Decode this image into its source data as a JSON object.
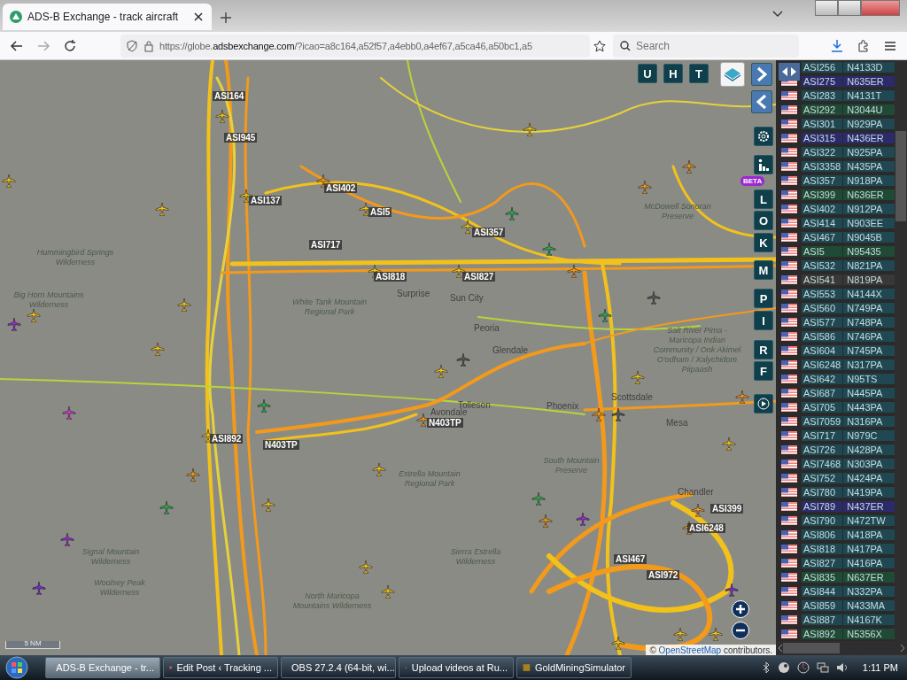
{
  "browser": {
    "tab": {
      "title": "ADS-B Exchange - track aircraft",
      "selected": true
    },
    "url": {
      "scheme": "https://globe.",
      "domain": "adsbexchange.com",
      "rest": "/?icao=a8c164,a52f57,a4ebb0,a4ef67,a5ca46,a50bc1,a5"
    },
    "search": {
      "placeholder": "Search"
    }
  },
  "map": {
    "top_buttons": [
      "U",
      "H",
      "T"
    ],
    "side_buttons": [
      "L",
      "O",
      "K",
      "M",
      "P",
      "I",
      "R",
      "F"
    ],
    "beta_badge": "BETA",
    "places": [
      "Hummingbird Springs Wilderness",
      "Big Horn Mountains Wilderness",
      "White Tank Mountain Regional Park",
      "Surprise",
      "Sun City",
      "Peoria",
      "Glendale",
      "Tolleson",
      "Avondale",
      "Phoenix",
      "Scottsdale",
      "Mesa",
      "Chandler",
      "Estrella Mountain Regional Park",
      "South Mountain Preserve",
      "Signal Mountain Wilderness",
      "Sierra Estrella Wilderness",
      "Woolsey Peak Wilderness",
      "North Maricopa Mountains Wilderness",
      "McDowell Sonoran Preserve",
      "Salt River Pima - Maricopa Indian Community / Onk Akimel O'odham / Xalychidom Piipaash"
    ],
    "aircraft_labels": [
      "ASI164",
      "ASI945",
      "ASI137",
      "ASI402",
      "ASI5",
      "ASI717",
      "ASI357",
      "ASI818",
      "ASI827",
      "ASI892",
      "N403TP",
      "N403TP",
      "ASI399",
      "ASI6248",
      "ASI467",
      "ASI972"
    ],
    "scale": "5 NM",
    "attribution": {
      "prefix": "©",
      "link": "OpenStreetMap",
      "suffix": "contributors."
    }
  },
  "aircraft_list": [
    {
      "callsign": "ASI256",
      "registration": "N4133D",
      "color": "#1f4853"
    },
    {
      "callsign": "ASI275",
      "registration": "N635ER",
      "color": "#2b2b6b"
    },
    {
      "callsign": "ASI283",
      "registration": "N4131T",
      "color": "#1f4853"
    },
    {
      "callsign": "ASI292",
      "registration": "N3044U",
      "color": "#1f4a35"
    },
    {
      "callsign": "ASI301",
      "registration": "N929PA",
      "color": "#1f4853"
    },
    {
      "callsign": "ASI315",
      "registration": "N436ER",
      "color": "#2b2b6b"
    },
    {
      "callsign": "ASI322",
      "registration": "N925PA",
      "color": "#1f4853"
    },
    {
      "callsign": "ASI3358",
      "registration": "N435PA",
      "color": "#1f4853"
    },
    {
      "callsign": "ASI357",
      "registration": "N918PA",
      "color": "#1f4853"
    },
    {
      "callsign": "ASI399",
      "registration": "N636ER",
      "color": "#1f4a35"
    },
    {
      "callsign": "ASI402",
      "registration": "N912PA",
      "color": "#1f4853"
    },
    {
      "callsign": "ASI414",
      "registration": "N903EE",
      "color": "#1f4853"
    },
    {
      "callsign": "ASI467",
      "registration": "N9045B",
      "color": "#1f4853"
    },
    {
      "callsign": "ASI5",
      "registration": "N95435",
      "color": "#1f4a35"
    },
    {
      "callsign": "ASI532",
      "registration": "N821PA",
      "color": "#1f4853"
    },
    {
      "callsign": "ASI541",
      "registration": "N819PA",
      "color": "#383838"
    },
    {
      "callsign": "ASI553",
      "registration": "N4144X",
      "color": "#1f4853"
    },
    {
      "callsign": "ASI560",
      "registration": "N749PA",
      "color": "#1f4853"
    },
    {
      "callsign": "ASI577",
      "registration": "N748PA",
      "color": "#1f4853"
    },
    {
      "callsign": "ASI586",
      "registration": "N746PA",
      "color": "#1f4853"
    },
    {
      "callsign": "ASI604",
      "registration": "N745PA",
      "color": "#1f4853"
    },
    {
      "callsign": "ASI6248",
      "registration": "N317PA",
      "color": "#1f4853"
    },
    {
      "callsign": "ASI642",
      "registration": "N95TS",
      "color": "#1f4853"
    },
    {
      "callsign": "ASI687",
      "registration": "N445PA",
      "color": "#1f4853"
    },
    {
      "callsign": "ASI705",
      "registration": "N443PA",
      "color": "#1f4853"
    },
    {
      "callsign": "ASI7059",
      "registration": "N316PA",
      "color": "#1f4853"
    },
    {
      "callsign": "ASI717",
      "registration": "N979C",
      "color": "#1f4853"
    },
    {
      "callsign": "ASI726",
      "registration": "N428PA",
      "color": "#1f4853"
    },
    {
      "callsign": "ASI7468",
      "registration": "N303PA",
      "color": "#1f4853"
    },
    {
      "callsign": "ASI752",
      "registration": "N424PA",
      "color": "#1f4853"
    },
    {
      "callsign": "ASI780",
      "registration": "N419PA",
      "color": "#1f4853"
    },
    {
      "callsign": "ASI789",
      "registration": "N437ER",
      "color": "#2b2b6b"
    },
    {
      "callsign": "ASI790",
      "registration": "N472TW",
      "color": "#1f4853"
    },
    {
      "callsign": "ASI806",
      "registration": "N418PA",
      "color": "#1f4853"
    },
    {
      "callsign": "ASI818",
      "registration": "N417PA",
      "color": "#1f4853"
    },
    {
      "callsign": "ASI827",
      "registration": "N416PA",
      "color": "#1f4853"
    },
    {
      "callsign": "ASI835",
      "registration": "N637ER",
      "color": "#1f4a35"
    },
    {
      "callsign": "ASI844",
      "registration": "N332PA",
      "color": "#1f4853"
    },
    {
      "callsign": "ASI859",
      "registration": "N433MA",
      "color": "#1f4853"
    },
    {
      "callsign": "ASI887",
      "registration": "N4167K",
      "color": "#1f4853"
    },
    {
      "callsign": "ASI892",
      "registration": "N5356X",
      "color": "#1f4a35"
    }
  ],
  "taskbar": {
    "tasks": [
      {
        "label": "ADS-B Exchange - tr...",
        "selected": true,
        "kind": "firefox"
      },
      {
        "label": "Edit Post ‹ Tracking ...",
        "selected": false,
        "kind": "firefox"
      },
      {
        "label": "OBS 27.2.4 (64-bit, wi...",
        "selected": false,
        "kind": "obs"
      },
      {
        "label": "Upload videos at Ru...",
        "selected": false,
        "kind": "upload"
      },
      {
        "label": "GoldMiningSimulator",
        "selected": false,
        "kind": "game"
      }
    ],
    "time": "1:11 PM"
  }
}
